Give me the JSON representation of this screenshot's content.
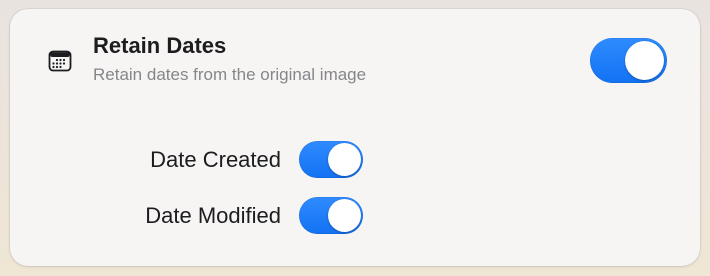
{
  "setting": {
    "icon": "calendar-icon",
    "title": "Retain Dates",
    "subtitle": "Retain dates from the original image",
    "enabled": true
  },
  "options": [
    {
      "label": "Date Created",
      "enabled": true
    },
    {
      "label": "Date Modified",
      "enabled": true
    }
  ],
  "colors": {
    "accent": "#1a7cf8",
    "card_background": "#f6f5f4",
    "title_text": "#1d1d1f",
    "subtitle_text": "#86868b"
  }
}
